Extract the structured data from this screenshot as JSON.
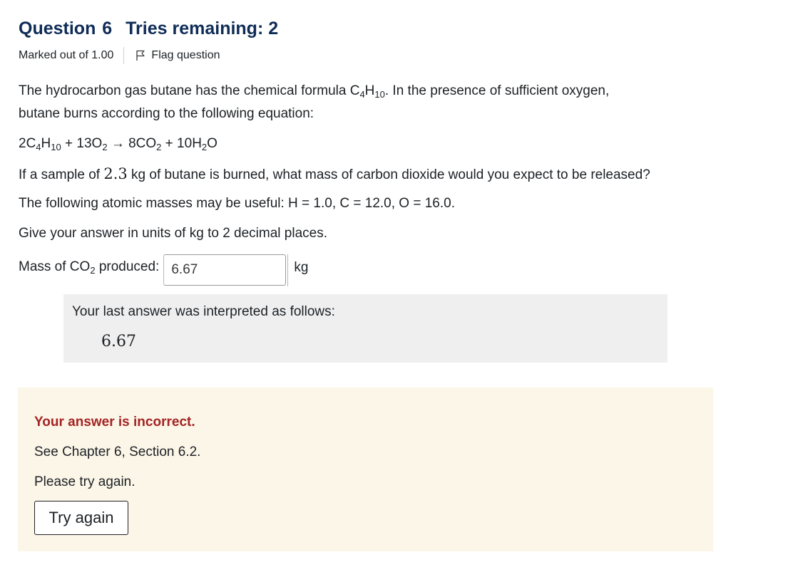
{
  "question": {
    "label": "Question",
    "number": "6",
    "tries": "Tries remaining: 2",
    "marked": "Marked out of 1.00",
    "flag": "Flag question"
  },
  "body": {
    "intro_1a": "The hydrocarbon gas butane has the chemical formula C",
    "intro_1b": "4",
    "intro_1c": "H",
    "intro_1d": "10",
    "intro_1e": ". In the presence of sufficient oxygen,",
    "intro_2": "butane burns according to the following equation:",
    "eq_a": "2C",
    "eq_b": "4",
    "eq_c": "H",
    "eq_d": "10",
    "eq_e": " + 13O",
    "eq_f": "2",
    "eq_g": " → 8CO",
    "eq_h": "2",
    "eq_i": " + 10H",
    "eq_j": "2",
    "eq_k": "O",
    "sample_a": "If a sample of ",
    "sample_num": "2.3",
    "sample_b": " kg of butane is burned, what mass of carbon dioxide would you expect to be released?",
    "masses": "The following atomic masses may be useful: H = 1.0, C = 12.0, O = 16.0.",
    "units": "Give your answer in units of kg to 2 decimal places."
  },
  "answer": {
    "label_a": "Mass of CO",
    "label_b": "2",
    "label_c": " produced:",
    "value": "6.67",
    "unit": "kg"
  },
  "interpretation": {
    "message": "Your last answer was interpreted as follows:",
    "value": "6.67"
  },
  "feedback": {
    "status": "Your answer is incorrect.",
    "reference": "See Chapter 6, Section 6.2.",
    "retry_msg": "Please try again.",
    "button": "Try again"
  },
  "colors": {
    "header": "#0f2c57",
    "incorrect": "#a42424",
    "feedback_bg": "#fcf6e8",
    "interp_bg": "#efefef"
  }
}
